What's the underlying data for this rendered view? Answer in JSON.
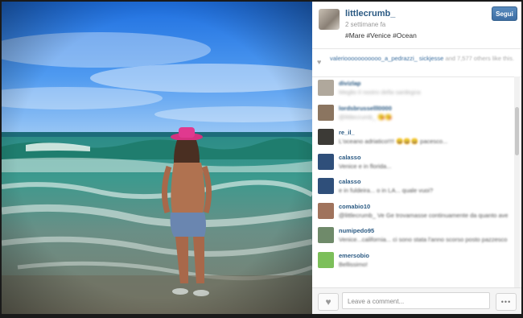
{
  "post": {
    "username": "littlecrumb_",
    "time_ago": "2 settimane fa",
    "caption": "#Mare #Venice #Ocean",
    "follow_label": "Segui"
  },
  "likes": {
    "names": "valeriooooooooooo_a_pedrazzi_ sickjesse",
    "others": "and 7,577 others like this."
  },
  "comments": [
    {
      "user": "divizlap",
      "text": "Meglio il nostro della sardegna",
      "avatar_color": "#b0a89c",
      "blur": true
    },
    {
      "user": "lordsbrusselll0000",
      "text": "@littlecrumb_ 😘😘",
      "avatar_color": "#8b7560",
      "blur": true
    },
    {
      "user": "re_il_",
      "text": "L'oceano adriatico!!!! 😄😄😄 pacesco...",
      "avatar_color": "#3c3a36",
      "blur": false
    },
    {
      "user": "calasso",
      "text": "Venice e in florida...",
      "avatar_color": "#2f4f7a",
      "blur": false
    },
    {
      "user": "calasso",
      "text": "e in fuldeira... o in LA... quale vuoi?",
      "avatar_color": "#2f4f7a",
      "blur": false
    },
    {
      "user": "comabio10",
      "text": "@littlecrumb_ Ve Ge trovamasse continuamente da quanto avevi 15 anni !! Urca !!",
      "avatar_color": "#a0735c",
      "blur": false
    },
    {
      "user": "numipedo95",
      "text": "Venice...california... ci sono stata l'anno scorso posto pazzesco... bellissimo!",
      "avatar_color": "#6f8a6a",
      "blur": false
    },
    {
      "user": "emersobio",
      "text": "Bellissimo!",
      "avatar_color": "#7cbf5a",
      "blur": false
    }
  ],
  "footer": {
    "comment_placeholder": "Leave a comment...",
    "more_label": "•••"
  },
  "colors": {
    "username": "#2b5a83",
    "follow_button": "#4a7db3"
  }
}
